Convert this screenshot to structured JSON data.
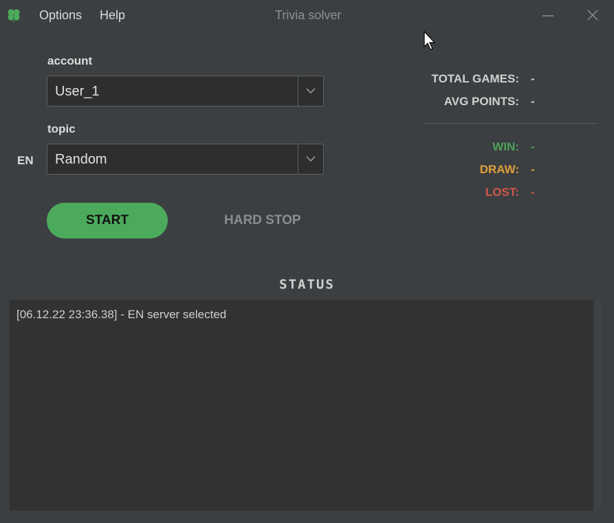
{
  "window": {
    "title": "Trivia solver",
    "icon": "clover-icon",
    "menu": [
      "Options",
      "Help"
    ]
  },
  "account": {
    "label": "account",
    "value": "User_1"
  },
  "topic": {
    "label": "topic",
    "value": "Random",
    "language": "EN"
  },
  "buttons": {
    "start": "START",
    "hard_stop": "HARD STOP"
  },
  "stats": {
    "total_games_label": "TOTAL GAMES:",
    "total_games_value": "-",
    "avg_points_label": "AVG POINTS:",
    "avg_points_value": "-",
    "win_label": "WIN:",
    "win_value": "-",
    "draw_label": "DRAW:",
    "draw_value": "-",
    "lost_label": "LOST:",
    "lost_value": "-"
  },
  "status": {
    "title": "STATUS",
    "lines": [
      "[06.12.22 23:36.38] - EN server selected"
    ]
  },
  "colors": {
    "background": "#3c3f41",
    "accent_green": "#4caa5c",
    "win": "#4ea15a",
    "draw": "#e0a03a",
    "lost": "#d0574a"
  }
}
